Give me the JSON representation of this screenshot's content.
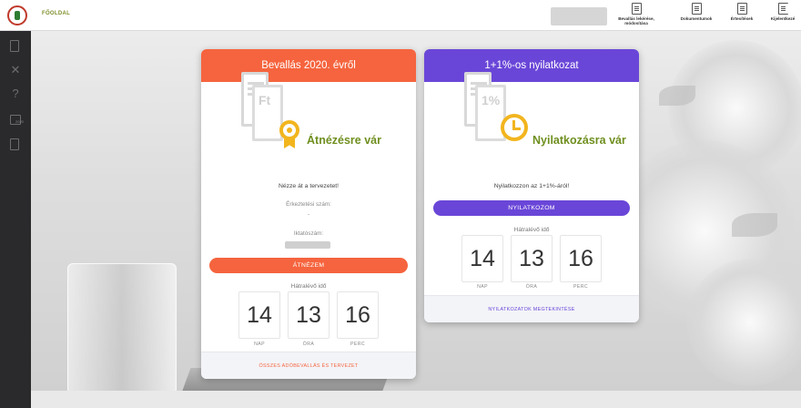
{
  "topbar": {
    "home": "FŐOLDAL",
    "buttons": [
      {
        "label1": "Bevallás lekérése,",
        "label2": "módosítása",
        "icon": "document-search-icon"
      },
      {
        "label1": "Dokumentumok",
        "label2": "",
        "icon": "documents-icon"
      },
      {
        "label1": "Értesítések",
        "label2": "",
        "icon": "notifications-icon"
      },
      {
        "label1": "Kijelentkezé",
        "label2": "",
        "icon": "logout-icon"
      }
    ]
  },
  "sidebar": {
    "items": [
      {
        "icon": "document-list-icon"
      },
      {
        "icon": "person-icon",
        "glyph": "✕"
      },
      {
        "icon": "help-icon",
        "glyph": "?"
      },
      {
        "icon": "calendar-2020-icon",
        "text": "2020"
      },
      {
        "icon": "archive-icon"
      }
    ]
  },
  "cards": {
    "tax": {
      "title": "Bevallás 2020. évről",
      "illustration_text": "Ft",
      "status": "Átnézésre vár",
      "message": "Nézze át a tervezetet!",
      "registration_label": "Érkeztetési szám:",
      "registration_value": "-",
      "filing_label": "Iktatószám:",
      "cta": "ÁTNÉZEM",
      "remaining_label": "Hátralévő idő",
      "days": "14",
      "hours": "13",
      "minutes": "16",
      "days_label": "NAP",
      "hours_label": "ÓRA",
      "minutes_label": "PERC",
      "footer": "ÖSSZES ADÓBEVALLÁS ÉS TERVEZET"
    },
    "declaration": {
      "title": "1+1%-os nyilatkozat",
      "illustration_text": "1%",
      "status": "Nyilatkozásra vár",
      "message": "Nyilatkozzon az 1+1%-áról!",
      "cta": "NYILATKOZOM",
      "remaining_label": "Hátralévő idő",
      "days": "14",
      "hours": "13",
      "minutes": "16",
      "days_label": "NAP",
      "hours_label": "ÓRA",
      "minutes_label": "PERC",
      "footer": "NYILATKOZATOK MEGTEKINTÉSE"
    }
  },
  "colors": {
    "tax_accent": "#f5643e",
    "declaration_accent": "#6a46d8",
    "status_text": "#6f8f1f",
    "badge": "#f2b51e"
  }
}
